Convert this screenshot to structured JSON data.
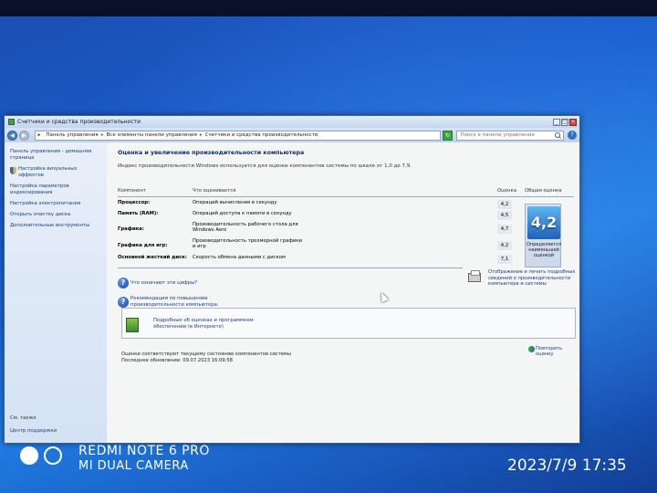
{
  "window": {
    "title": "Счетчики и средства производительности"
  },
  "nav": {
    "breadcrumb": [
      "Панель управления",
      "Все элементы панели управления",
      "Счетчики и средства производительности"
    ],
    "search_placeholder": "Поиск в панели управления"
  },
  "sidebar": {
    "items": [
      {
        "label": "Панель управления - домашняя страница"
      },
      {
        "label": "Настройка визуальных эффектов"
      },
      {
        "label": "Настройка параметров индексирования"
      },
      {
        "label": "Настройка электропитания"
      },
      {
        "label": "Открыть очистку диска"
      },
      {
        "label": "Дополнительные инструменты"
      }
    ],
    "see_also": "См. также",
    "support": "Центр поддержки"
  },
  "main": {
    "heading": "Оценка и увеличение производительности компьютера",
    "subheading": "Индекс производительности Windows используется для оценки компонентов системы по шкале от 1,0 до 7,9.",
    "columns": {
      "component": "Компонент",
      "what": "Что оценивается",
      "score": "Оценка",
      "overall": "Общая оценка"
    },
    "rows": [
      {
        "component": "Процессор:",
        "what": "Операций вычисления в секунду",
        "score": "4,2"
      },
      {
        "component": "Память (RAM):",
        "what": "Операций доступа к памяти в секунду",
        "score": "4,5"
      },
      {
        "component": "Графика:",
        "what": "Производительность рабочего стола для Windows Aero",
        "score": "4,7"
      },
      {
        "component": "Графика для игр:",
        "what": "Производительность трехмерной графики и игр",
        "score": "4,2"
      },
      {
        "component": "Основной жесткий диск:",
        "what": "Скорость обмена данными с диском",
        "score": "7,1"
      }
    ],
    "overall_score": "4,2",
    "overall_caption": "Определяется наименьшей оценкой",
    "help_links": [
      "Что означают эти цифры?",
      "Рекомендации по повышению производительности компьютера."
    ],
    "print_link": "Отображение и печать подробных сведений о производительности компьютера и системы",
    "info_link": "Подробные об оценках и программном обеспечении (в Интернете)",
    "status_current": "Оценки соответствуют текущему состоянию компонентов системы",
    "status_last": "Последнее обновление: 09.07.2023 16:09:58",
    "repeat_link": "Повторить оценку"
  },
  "watermark": {
    "model": "REDMI NOTE 6 PRO",
    "camera": "MI DUAL CAMERA",
    "datetime": "2023/7/9  17:35"
  }
}
